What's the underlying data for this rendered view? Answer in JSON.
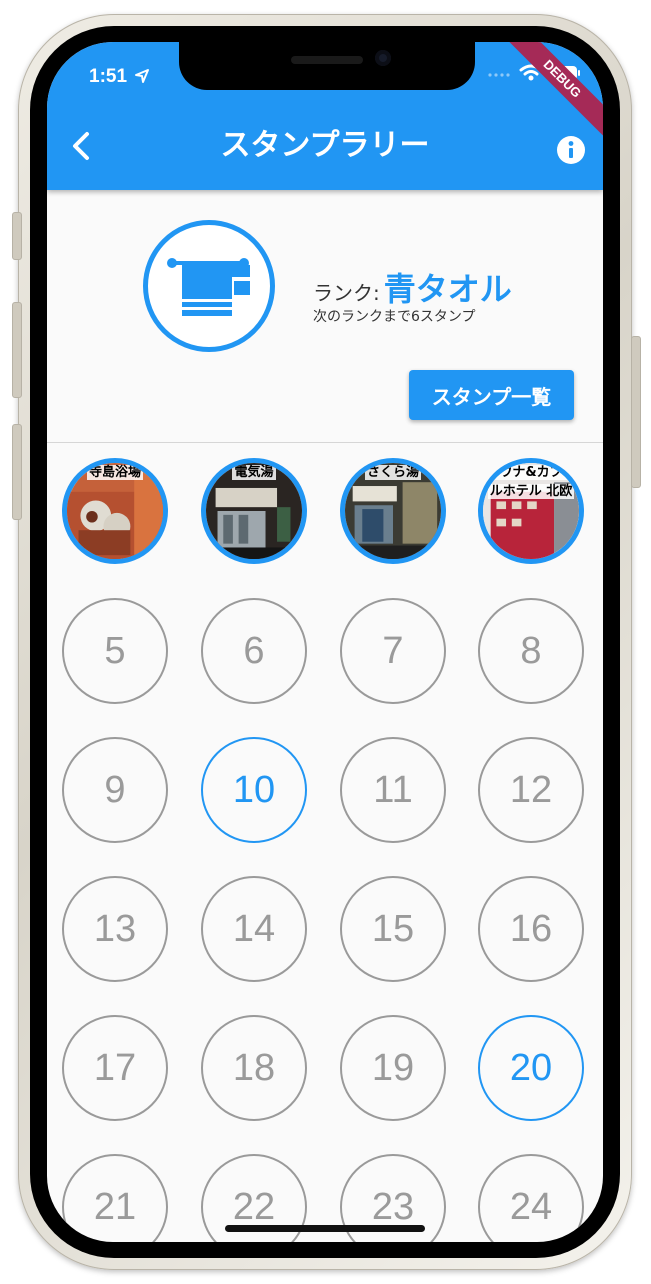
{
  "status_bar": {
    "time": "1:51"
  },
  "debug_banner": "DEBUG",
  "app_bar": {
    "title": "スタンプラリー"
  },
  "rank": {
    "label": "ランク:",
    "value": "青タオル",
    "next_text": "次のランクまで6スタンプ"
  },
  "stamp_list_button": "スタンプ一覧",
  "colors": {
    "accent": "#2196f3",
    "inactive": "#9a9a9a",
    "background": "#fafafa"
  },
  "visited_stamps": [
    {
      "caption": "寺島浴場"
    },
    {
      "caption": "電気湯"
    },
    {
      "caption": "さくら湯"
    },
    {
      "caption": "サウナ&カプセルホテル 北欧",
      "caption_line1": "サウナ&カプセ",
      "caption_line2": "ルホテル 北欧"
    }
  ],
  "stamp_numbers": [
    "5",
    "6",
    "7",
    "8",
    "9",
    "10",
    "11",
    "12",
    "13",
    "14",
    "15",
    "16",
    "17",
    "18",
    "19",
    "20",
    "21",
    "22",
    "23",
    "24"
  ],
  "highlighted_numbers": [
    "10",
    "20"
  ]
}
